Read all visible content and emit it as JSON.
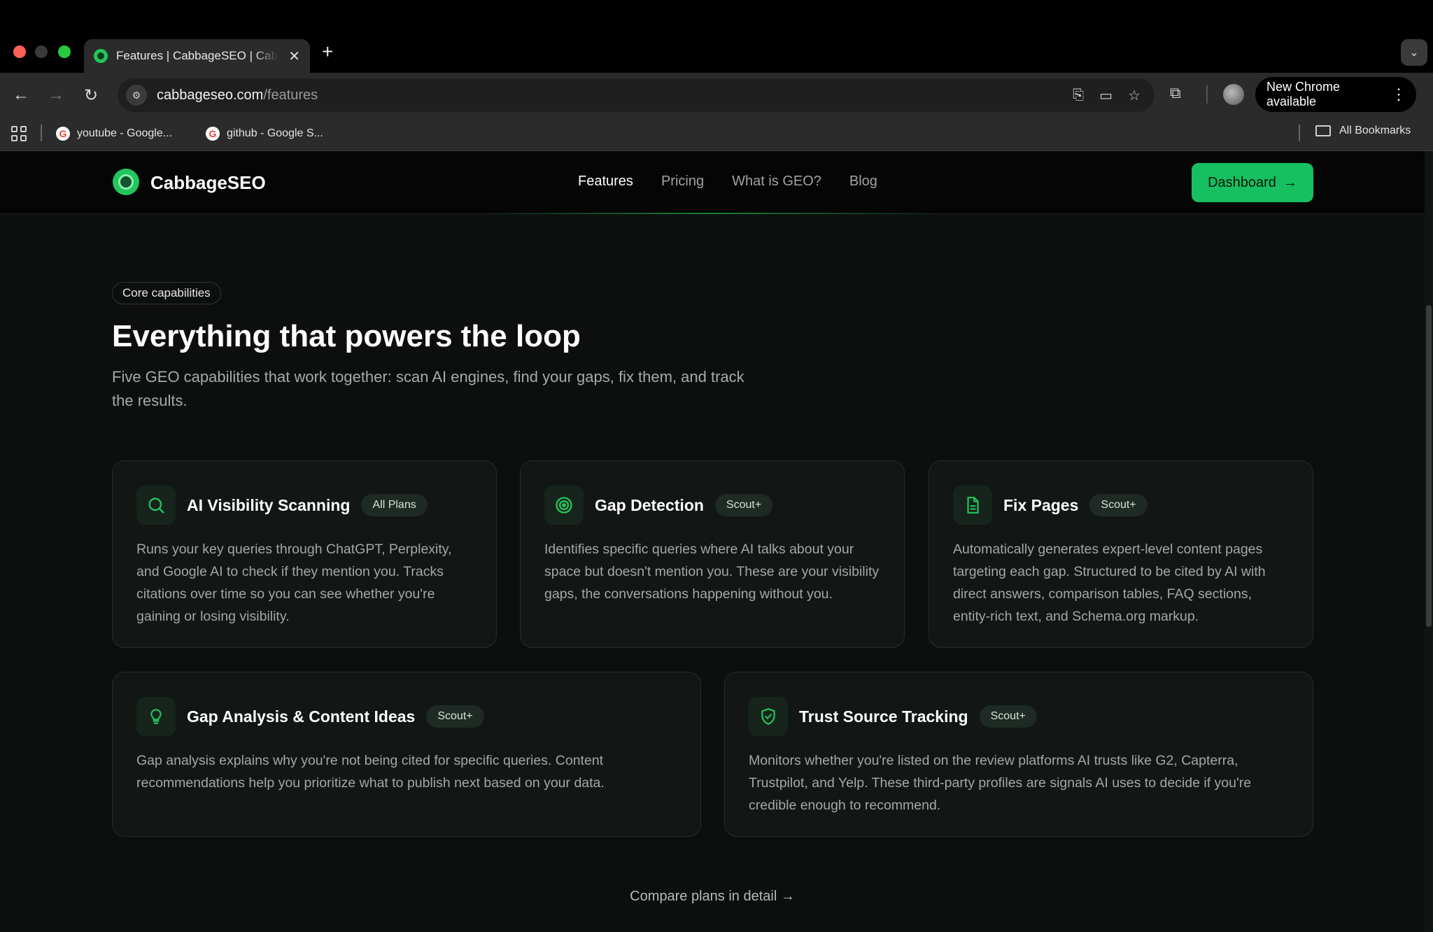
{
  "browser": {
    "tab_title": "Features | CabbageSEO | CabbageSEO",
    "tab_close": "✕",
    "new_tab": "+",
    "tab_list": "⌄",
    "url_host": "cabbageseo.com",
    "url_path": "/features",
    "update_label": "New Chrome available",
    "menu_dots": "⋮",
    "bookmarks": [
      {
        "label": "youtube - Google..."
      },
      {
        "label": "github - Google S..."
      }
    ],
    "all_bookmarks": "All Bookmarks"
  },
  "site": {
    "brand": "CabbageSEO",
    "nav": [
      {
        "label": "Features"
      },
      {
        "label": "Pricing"
      },
      {
        "label": "What is GEO?"
      },
      {
        "label": "Blog"
      }
    ],
    "dashboard_label": "Dashboard",
    "dashboard_arrow": "→"
  },
  "hero": {
    "eyebrow": "Core capabilities",
    "title": "Everything that powers the loop",
    "subtitle": "Five GEO capabilities that work together: scan AI engines, find your gaps, fix them, and track the results."
  },
  "cards": [
    {
      "title": "AI Visibility Scanning",
      "badge": "All Plans",
      "icon": "search-icon",
      "body": "Runs your key queries through ChatGPT, Perplexity, and Google AI to check if they mention you. Tracks citations over time so you can see whether you're gaining or losing visibility."
    },
    {
      "title": "Gap Detection",
      "badge": "Scout+",
      "icon": "target-icon",
      "body": "Identifies specific queries where AI talks about your space but doesn't mention you. These are your visibility gaps, the conversations happening without you."
    },
    {
      "title": "Fix Pages",
      "badge": "Scout+",
      "icon": "document-icon",
      "body": "Automatically generates expert-level content pages targeting each gap. Structured to be cited by AI with direct answers, comparison tables, FAQ sections, entity-rich text, and Schema.org markup."
    },
    {
      "title": "Gap Analysis & Content Ideas",
      "badge": "Scout+",
      "icon": "lightbulb-icon",
      "body": "Gap analysis explains why you're not being cited for specific queries. Content recommendations help you prioritize what to publish next based on your data."
    },
    {
      "title": "Trust Source Tracking",
      "badge": "Scout+",
      "icon": "shield-check-icon",
      "body": "Monitors whether you're listed on the review platforms AI trusts like G2, Capterra, Trustpilot, and Yelp. These third-party profiles are signals AI uses to decide if you're credible enough to recommend."
    }
  ],
  "compare_link": "Compare plans in detail →",
  "colors": {
    "accent": "#16c060",
    "page_bg": "#0d0f0e",
    "card_bg": "#121614"
  }
}
